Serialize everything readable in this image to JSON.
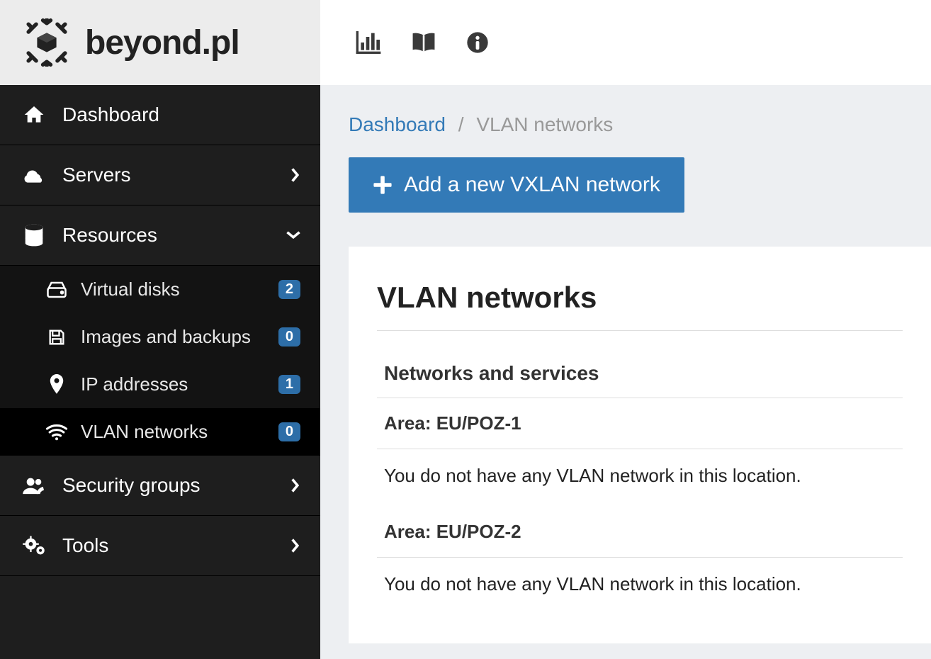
{
  "brand": {
    "name": "beyond.pl"
  },
  "sidebar": {
    "dashboard": "Dashboard",
    "servers": "Servers",
    "resources": "Resources",
    "security_groups": "Security groups",
    "tools": "Tools",
    "sub": {
      "virtual_disks": {
        "label": "Virtual disks",
        "badge": "2"
      },
      "images_backups": {
        "label": "Images and backups",
        "badge": "0"
      },
      "ip_addresses": {
        "label": "IP addresses",
        "badge": "1"
      },
      "vlan_networks": {
        "label": "VLAN networks",
        "badge": "0"
      }
    }
  },
  "breadcrumb": {
    "dashboard": "Dashboard",
    "current": "VLAN networks"
  },
  "button_add": "Add a new VXLAN network",
  "page_title": "VLAN networks",
  "section_header": "Networks and services",
  "areas": [
    {
      "label": "Area: EU/POZ-1",
      "empty": "You do not have any VLAN network in this location."
    },
    {
      "label": "Area: EU/POZ-2",
      "empty": "You do not have any VLAN network in this location."
    }
  ]
}
